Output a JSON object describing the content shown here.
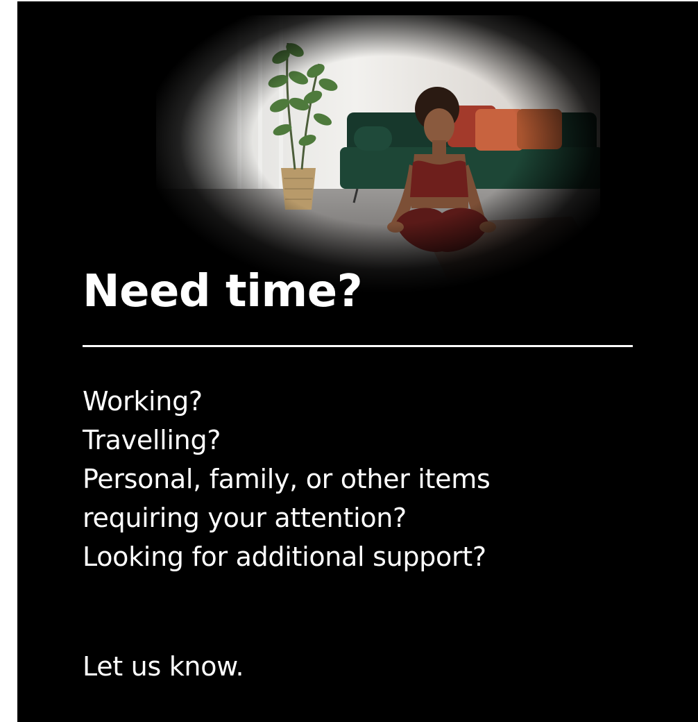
{
  "card": {
    "headline": "Need time?",
    "questions": [
      "Working?",
      "Travelling?",
      "Personal, family, or other items",
      "requiring your attention?",
      "Looking for additional support?"
    ],
    "cta": "Let us know."
  },
  "photo": {
    "icon": "woman-meditating-photo"
  },
  "colors": {
    "background": "#000000",
    "text": "#ffffff",
    "divider": "#ffffff"
  }
}
